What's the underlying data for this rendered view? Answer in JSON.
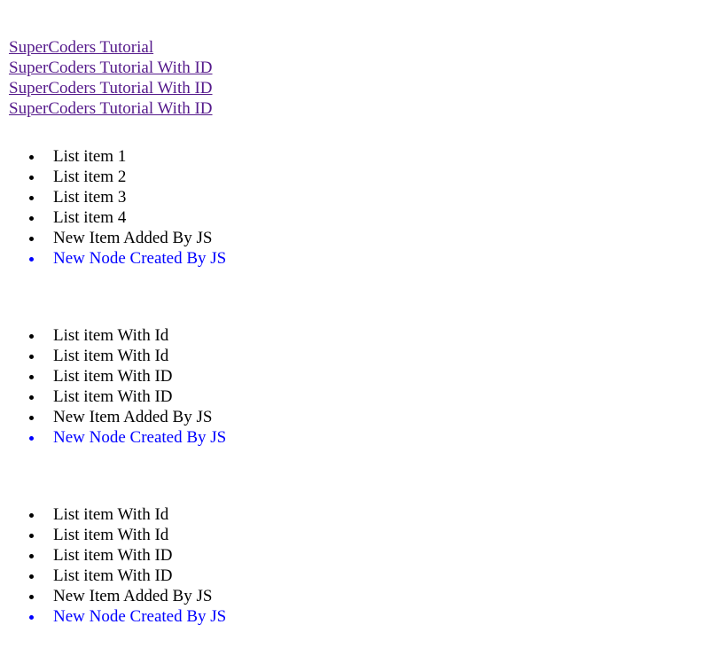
{
  "colors": {
    "visited_link": "#551a8b",
    "created_node_text": "#0000ff",
    "text": "#000000",
    "background": "#ffffff"
  },
  "links": [
    "SuperCoders Tutorial",
    "SuperCoders Tutorial With ID",
    "SuperCoders Tutorial With ID",
    "SuperCoders Tutorial With ID"
  ],
  "lists": [
    {
      "items": [
        "List item 1",
        "List item 2",
        "List item 3",
        "List item 4",
        "New Item Added By JS"
      ],
      "created_node": "New Node Created By JS"
    },
    {
      "items": [
        "List item With Id",
        "List item With Id",
        "List item With ID",
        "List item With ID",
        "New Item Added By JS"
      ],
      "created_node": "New Node Created By JS"
    },
    {
      "items": [
        "List item With Id",
        "List item With Id",
        "List item With ID",
        "List item With ID",
        "New Item Added By JS"
      ],
      "created_node": "New Node Created By JS"
    }
  ]
}
